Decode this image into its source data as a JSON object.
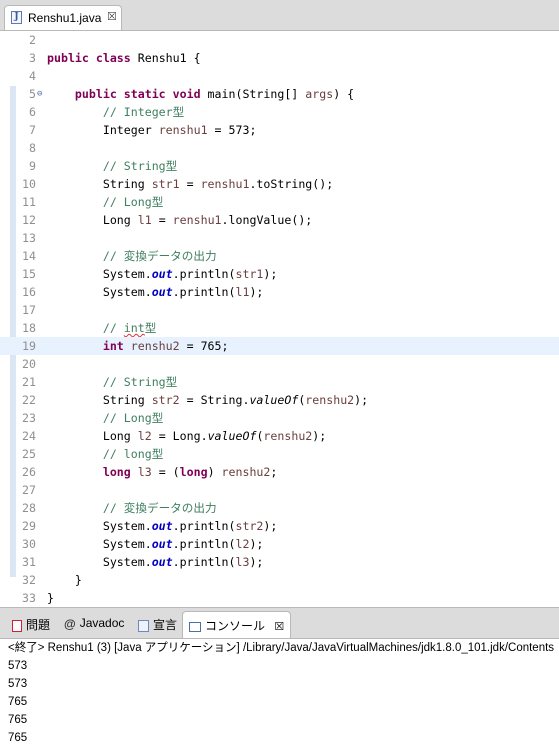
{
  "editor_tab": {
    "filename": "Renshu1.java",
    "close": "☒"
  },
  "code_lines": [
    {
      "n": "2",
      "text": ""
    },
    {
      "n": "3",
      "tokens": [
        {
          "t": "public class ",
          "c": "kw"
        },
        {
          "t": "Renshu1 {"
        }
      ]
    },
    {
      "n": "4",
      "text": ""
    },
    {
      "n": "5",
      "fold": true,
      "tokens": [
        {
          "t": "    "
        },
        {
          "t": "public static void ",
          "c": "kw"
        },
        {
          "t": "main(String[] "
        },
        {
          "t": "args",
          "c": "var"
        },
        {
          "t": ") {"
        }
      ]
    },
    {
      "n": "6",
      "tokens": [
        {
          "t": "        "
        },
        {
          "t": "// Integer型",
          "c": "cm"
        }
      ]
    },
    {
      "n": "7",
      "tokens": [
        {
          "t": "        Integer "
        },
        {
          "t": "renshu1",
          "c": "var"
        },
        {
          "t": " = 573;"
        }
      ]
    },
    {
      "n": "8",
      "text": ""
    },
    {
      "n": "9",
      "tokens": [
        {
          "t": "        "
        },
        {
          "t": "// String型",
          "c": "cm"
        }
      ]
    },
    {
      "n": "10",
      "tokens": [
        {
          "t": "        String "
        },
        {
          "t": "str1",
          "c": "var"
        },
        {
          "t": " = "
        },
        {
          "t": "renshu1",
          "c": "var"
        },
        {
          "t": ".toString();"
        }
      ]
    },
    {
      "n": "11",
      "tokens": [
        {
          "t": "        "
        },
        {
          "t": "// Long型",
          "c": "cm"
        }
      ]
    },
    {
      "n": "12",
      "tokens": [
        {
          "t": "        Long "
        },
        {
          "t": "l1",
          "c": "var"
        },
        {
          "t": " = "
        },
        {
          "t": "renshu1",
          "c": "var"
        },
        {
          "t": ".longValue();"
        }
      ]
    },
    {
      "n": "13",
      "text": ""
    },
    {
      "n": "14",
      "tokens": [
        {
          "t": "        "
        },
        {
          "t": "// 変換データの出力",
          "c": "cm"
        }
      ]
    },
    {
      "n": "15",
      "tokens": [
        {
          "t": "        System."
        },
        {
          "t": "out",
          "c": "fld"
        },
        {
          "t": ".println("
        },
        {
          "t": "str1",
          "c": "var"
        },
        {
          "t": ");"
        }
      ]
    },
    {
      "n": "16",
      "tokens": [
        {
          "t": "        System."
        },
        {
          "t": "out",
          "c": "fld"
        },
        {
          "t": ".println("
        },
        {
          "t": "l1",
          "c": "var"
        },
        {
          "t": ");"
        }
      ]
    },
    {
      "n": "17",
      "text": ""
    },
    {
      "n": "18",
      "tokens": [
        {
          "t": "        "
        },
        {
          "t": "// ",
          "c": "cm"
        },
        {
          "t": "int",
          "c": "cm squig"
        },
        {
          "t": "型",
          "c": "cm"
        }
      ]
    },
    {
      "n": "19",
      "current": true,
      "tokens": [
        {
          "t": "        "
        },
        {
          "t": "int ",
          "c": "kw"
        },
        {
          "t": "renshu2",
          "c": "var"
        },
        {
          "t": " = 765;"
        }
      ]
    },
    {
      "n": "20",
      "text": ""
    },
    {
      "n": "21",
      "tokens": [
        {
          "t": "        "
        },
        {
          "t": "// String型",
          "c": "cm"
        }
      ]
    },
    {
      "n": "22",
      "tokens": [
        {
          "t": "        String "
        },
        {
          "t": "str2",
          "c": "var"
        },
        {
          "t": " = String."
        },
        {
          "t": "valueOf",
          "c": "st"
        },
        {
          "t": "("
        },
        {
          "t": "renshu2",
          "c": "var"
        },
        {
          "t": ");"
        }
      ]
    },
    {
      "n": "23",
      "tokens": [
        {
          "t": "        "
        },
        {
          "t": "// Long型",
          "c": "cm"
        }
      ]
    },
    {
      "n": "24",
      "tokens": [
        {
          "t": "        Long "
        },
        {
          "t": "l2",
          "c": "var"
        },
        {
          "t": " = Long."
        },
        {
          "t": "valueOf",
          "c": "st"
        },
        {
          "t": "("
        },
        {
          "t": "renshu2",
          "c": "var"
        },
        {
          "t": ");"
        }
      ]
    },
    {
      "n": "25",
      "tokens": [
        {
          "t": "        "
        },
        {
          "t": "// long型",
          "c": "cm"
        }
      ]
    },
    {
      "n": "26",
      "tokens": [
        {
          "t": "        "
        },
        {
          "t": "long ",
          "c": "kw"
        },
        {
          "t": "l3",
          "c": "var"
        },
        {
          "t": " = ("
        },
        {
          "t": "long",
          "c": "kw"
        },
        {
          "t": ") "
        },
        {
          "t": "renshu2",
          "c": "var"
        },
        {
          "t": ";"
        }
      ]
    },
    {
      "n": "27",
      "text": ""
    },
    {
      "n": "28",
      "tokens": [
        {
          "t": "        "
        },
        {
          "t": "// 変換データの出力",
          "c": "cm"
        }
      ]
    },
    {
      "n": "29",
      "tokens": [
        {
          "t": "        System."
        },
        {
          "t": "out",
          "c": "fld"
        },
        {
          "t": ".println("
        },
        {
          "t": "str2",
          "c": "var"
        },
        {
          "t": ");"
        }
      ]
    },
    {
      "n": "30",
      "tokens": [
        {
          "t": "        System."
        },
        {
          "t": "out",
          "c": "fld"
        },
        {
          "t": ".println("
        },
        {
          "t": "l2",
          "c": "var"
        },
        {
          "t": ");"
        }
      ]
    },
    {
      "n": "31",
      "tokens": [
        {
          "t": "        System."
        },
        {
          "t": "out",
          "c": "fld"
        },
        {
          "t": ".println("
        },
        {
          "t": "l3",
          "c": "var"
        },
        {
          "t": ");"
        }
      ]
    },
    {
      "n": "32",
      "tokens": [
        {
          "t": "    }"
        }
      ]
    },
    {
      "n": "33",
      "tokens": [
        {
          "t": "}"
        }
      ]
    }
  ],
  "panel": {
    "tabs": {
      "problems": "問題",
      "javadoc": "Javadoc",
      "declaration": "宣言",
      "console": "コンソール",
      "console_close": "☒"
    },
    "console": {
      "status": "<終了> Renshu1 (3) [Java アプリケーション] /Library/Java/JavaVirtualMachines/jdk1.8.0_101.jdk/Contents",
      "output": [
        "573",
        "573",
        "765",
        "765",
        "765"
      ]
    }
  },
  "colors": {
    "keyword": "#7f0055",
    "comment": "#3f7f5f",
    "field": "#0000c0",
    "current_line": "#e8f2fe"
  },
  "icons": {
    "file": "java-file-icon",
    "fold": "fold-collapse-icon",
    "problems": "problems-icon",
    "javadoc": "javadoc-icon",
    "declaration": "declaration-icon",
    "console": "console-icon"
  }
}
